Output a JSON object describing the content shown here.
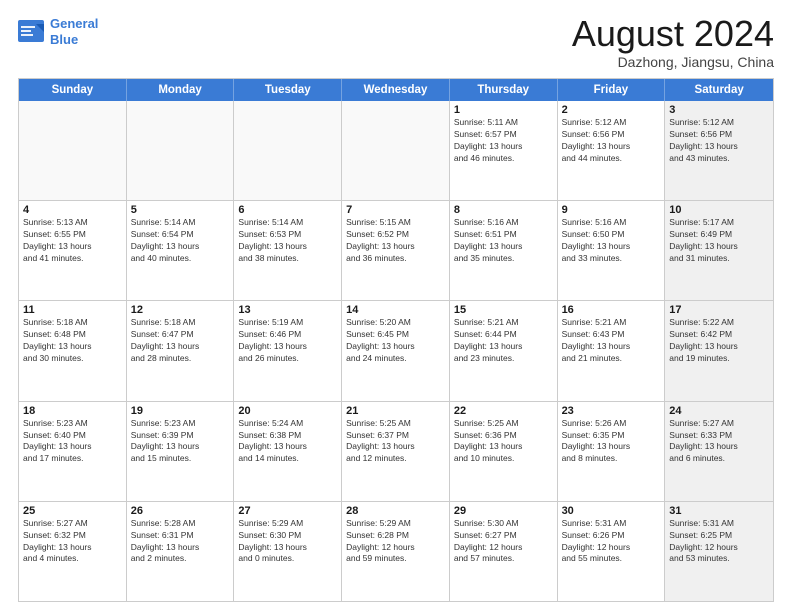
{
  "logo": {
    "line1": "General",
    "line2": "Blue"
  },
  "title": "August 2024",
  "location": "Dazhong, Jiangsu, China",
  "header": {
    "days": [
      "Sunday",
      "Monday",
      "Tuesday",
      "Wednesday",
      "Thursday",
      "Friday",
      "Saturday"
    ]
  },
  "rows": [
    {
      "cells": [
        {
          "day": "",
          "empty": true
        },
        {
          "day": "",
          "empty": true
        },
        {
          "day": "",
          "empty": true
        },
        {
          "day": "",
          "empty": true
        },
        {
          "day": "1",
          "text": "Sunrise: 5:11 AM\nSunset: 6:57 PM\nDaylight: 13 hours\nand 46 minutes."
        },
        {
          "day": "2",
          "text": "Sunrise: 5:12 AM\nSunset: 6:56 PM\nDaylight: 13 hours\nand 44 minutes."
        },
        {
          "day": "3",
          "shaded": true,
          "text": "Sunrise: 5:12 AM\nSunset: 6:56 PM\nDaylight: 13 hours\nand 43 minutes."
        }
      ]
    },
    {
      "cells": [
        {
          "day": "4",
          "text": "Sunrise: 5:13 AM\nSunset: 6:55 PM\nDaylight: 13 hours\nand 41 minutes."
        },
        {
          "day": "5",
          "text": "Sunrise: 5:14 AM\nSunset: 6:54 PM\nDaylight: 13 hours\nand 40 minutes."
        },
        {
          "day": "6",
          "text": "Sunrise: 5:14 AM\nSunset: 6:53 PM\nDaylight: 13 hours\nand 38 minutes."
        },
        {
          "day": "7",
          "text": "Sunrise: 5:15 AM\nSunset: 6:52 PM\nDaylight: 13 hours\nand 36 minutes."
        },
        {
          "day": "8",
          "text": "Sunrise: 5:16 AM\nSunset: 6:51 PM\nDaylight: 13 hours\nand 35 minutes."
        },
        {
          "day": "9",
          "text": "Sunrise: 5:16 AM\nSunset: 6:50 PM\nDaylight: 13 hours\nand 33 minutes."
        },
        {
          "day": "10",
          "shaded": true,
          "text": "Sunrise: 5:17 AM\nSunset: 6:49 PM\nDaylight: 13 hours\nand 31 minutes."
        }
      ]
    },
    {
      "cells": [
        {
          "day": "11",
          "text": "Sunrise: 5:18 AM\nSunset: 6:48 PM\nDaylight: 13 hours\nand 30 minutes."
        },
        {
          "day": "12",
          "text": "Sunrise: 5:18 AM\nSunset: 6:47 PM\nDaylight: 13 hours\nand 28 minutes."
        },
        {
          "day": "13",
          "text": "Sunrise: 5:19 AM\nSunset: 6:46 PM\nDaylight: 13 hours\nand 26 minutes."
        },
        {
          "day": "14",
          "text": "Sunrise: 5:20 AM\nSunset: 6:45 PM\nDaylight: 13 hours\nand 24 minutes."
        },
        {
          "day": "15",
          "text": "Sunrise: 5:21 AM\nSunset: 6:44 PM\nDaylight: 13 hours\nand 23 minutes."
        },
        {
          "day": "16",
          "text": "Sunrise: 5:21 AM\nSunset: 6:43 PM\nDaylight: 13 hours\nand 21 minutes."
        },
        {
          "day": "17",
          "shaded": true,
          "text": "Sunrise: 5:22 AM\nSunset: 6:42 PM\nDaylight: 13 hours\nand 19 minutes."
        }
      ]
    },
    {
      "cells": [
        {
          "day": "18",
          "text": "Sunrise: 5:23 AM\nSunset: 6:40 PM\nDaylight: 13 hours\nand 17 minutes."
        },
        {
          "day": "19",
          "text": "Sunrise: 5:23 AM\nSunset: 6:39 PM\nDaylight: 13 hours\nand 15 minutes."
        },
        {
          "day": "20",
          "text": "Sunrise: 5:24 AM\nSunset: 6:38 PM\nDaylight: 13 hours\nand 14 minutes."
        },
        {
          "day": "21",
          "text": "Sunrise: 5:25 AM\nSunset: 6:37 PM\nDaylight: 13 hours\nand 12 minutes."
        },
        {
          "day": "22",
          "text": "Sunrise: 5:25 AM\nSunset: 6:36 PM\nDaylight: 13 hours\nand 10 minutes."
        },
        {
          "day": "23",
          "text": "Sunrise: 5:26 AM\nSunset: 6:35 PM\nDaylight: 13 hours\nand 8 minutes."
        },
        {
          "day": "24",
          "shaded": true,
          "text": "Sunrise: 5:27 AM\nSunset: 6:33 PM\nDaylight: 13 hours\nand 6 minutes."
        }
      ]
    },
    {
      "cells": [
        {
          "day": "25",
          "text": "Sunrise: 5:27 AM\nSunset: 6:32 PM\nDaylight: 13 hours\nand 4 minutes."
        },
        {
          "day": "26",
          "text": "Sunrise: 5:28 AM\nSunset: 6:31 PM\nDaylight: 13 hours\nand 2 minutes."
        },
        {
          "day": "27",
          "text": "Sunrise: 5:29 AM\nSunset: 6:30 PM\nDaylight: 13 hours\nand 0 minutes."
        },
        {
          "day": "28",
          "text": "Sunrise: 5:29 AM\nSunset: 6:28 PM\nDaylight: 12 hours\nand 59 minutes."
        },
        {
          "day": "29",
          "text": "Sunrise: 5:30 AM\nSunset: 6:27 PM\nDaylight: 12 hours\nand 57 minutes."
        },
        {
          "day": "30",
          "text": "Sunrise: 5:31 AM\nSunset: 6:26 PM\nDaylight: 12 hours\nand 55 minutes."
        },
        {
          "day": "31",
          "shaded": true,
          "text": "Sunrise: 5:31 AM\nSunset: 6:25 PM\nDaylight: 12 hours\nand 53 minutes."
        }
      ]
    }
  ]
}
